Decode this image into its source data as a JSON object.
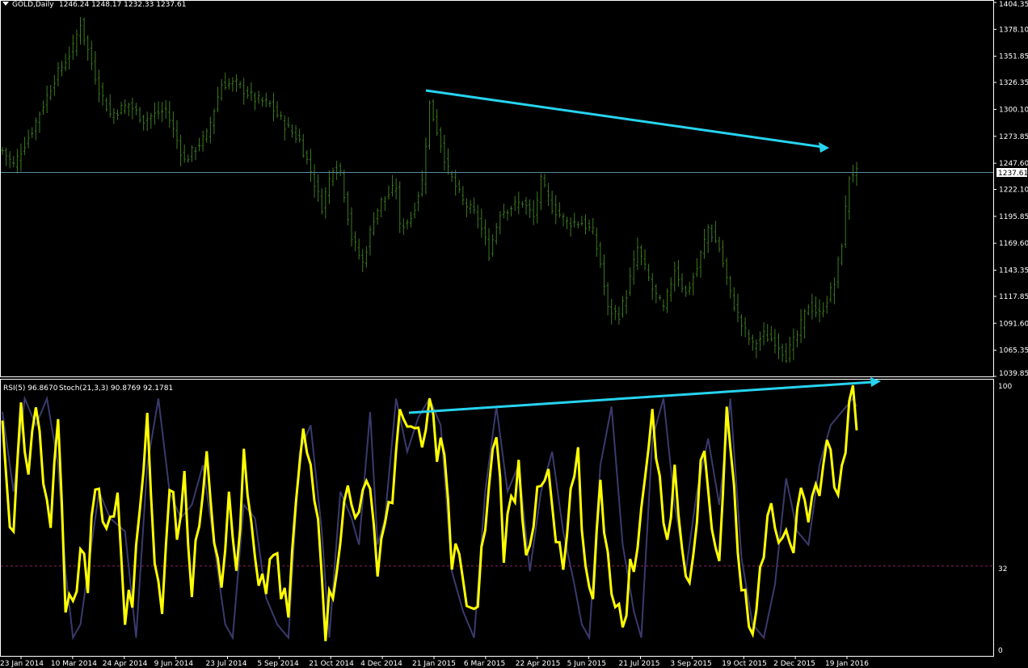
{
  "main_header": {
    "symbol_tf": "GOLD,Daily",
    "ohlc": "1246.24 1248.17 1232.33 1237.61"
  },
  "sub_header": {
    "rsi_label": "RSI(5) 96.8670",
    "stoch_label": "Stoch(21,3,3) 90.8769 92.1781"
  },
  "colors": {
    "background": "#000000",
    "frame": "#ffffff",
    "bars": "#3c7a1e",
    "bid_line": "#5a8a9a",
    "price_tag_bg": "#ffffff",
    "arrow": "#27d4f0",
    "rsi_line": "#ffff00",
    "stoch_line": "#3a3a6e",
    "level_line": "#8a2060"
  },
  "icons": {
    "header_marker": "down-triangle-icon"
  },
  "price_axis": [
    "1404.35",
    "1378.10",
    "1351.85",
    "1326.35",
    "1300.10",
    "1273.85",
    "1247.60",
    "1222.10",
    "1195.85",
    "1169.60",
    "1143.35",
    "1117.85",
    "1091.60",
    "1065.35",
    "1039.85"
  ],
  "current_price": "1237.61",
  "sub_axis": {
    "top": "100",
    "level": "32",
    "bottom": "0"
  },
  "date_axis": [
    "23 Jan 2014",
    "10 Mar 2014",
    "24 Apr 2014",
    "9 Jun 2014",
    "23 Jul 2014",
    "5 Sep 2014",
    "21 Oct 2014",
    "4 Dec 2014",
    "21 Jan 2015",
    "6 Mar 2015",
    "22 Apr 2015",
    "5 Jun 2015",
    "21 Jul 2015",
    "3 Sep 2015",
    "19 Oct 2015",
    "2 Dec 2015",
    "19 Jan 2016"
  ],
  "chart_data": {
    "type": "line",
    "series": [
      {
        "name": "GOLD,Daily",
        "anchors": [
          [
            0,
            1260
          ],
          [
            3,
            1246
          ],
          [
            8,
            1280
          ],
          [
            14,
            1330
          ],
          [
            19,
            1360
          ],
          [
            21,
            1385
          ],
          [
            22,
            1370
          ],
          [
            26,
            1320
          ],
          [
            29,
            1295
          ],
          [
            34,
            1305
          ],
          [
            38,
            1290
          ],
          [
            44,
            1300
          ],
          [
            49,
            1250
          ],
          [
            55,
            1275
          ],
          [
            59,
            1325
          ],
          [
            63,
            1325
          ],
          [
            68,
            1310
          ],
          [
            72,
            1305
          ],
          [
            76,
            1285
          ],
          [
            80,
            1270
          ],
          [
            83,
            1240
          ],
          [
            86,
            1205
          ],
          [
            89,
            1245
          ],
          [
            91,
            1240
          ],
          [
            94,
            1175
          ],
          [
            97,
            1150
          ],
          [
            100,
            1195
          ],
          [
            102,
            1210
          ],
          [
            106,
            1225
          ],
          [
            107,
            1185
          ],
          [
            110,
            1195
          ],
          [
            113,
            1230
          ],
          [
            115,
            1305
          ],
          [
            117,
            1280
          ],
          [
            120,
            1240
          ],
          [
            124,
            1210
          ],
          [
            128,
            1195
          ],
          [
            131,
            1160
          ],
          [
            134,
            1200
          ],
          [
            137,
            1205
          ],
          [
            140,
            1210
          ],
          [
            143,
            1195
          ],
          [
            145,
            1230
          ],
          [
            148,
            1205
          ],
          [
            152,
            1190
          ],
          [
            156,
            1190
          ],
          [
            159,
            1180
          ],
          [
            161,
            1150
          ],
          [
            163,
            1105
          ],
          [
            166,
            1100
          ],
          [
            168,
            1120
          ],
          [
            171,
            1165
          ],
          [
            175,
            1125
          ],
          [
            178,
            1105
          ],
          [
            181,
            1145
          ],
          [
            184,
            1120
          ],
          [
            187,
            1145
          ],
          [
            190,
            1185
          ],
          [
            193,
            1165
          ],
          [
            196,
            1120
          ],
          [
            199,
            1090
          ],
          [
            202,
            1070
          ],
          [
            205,
            1080
          ],
          [
            208,
            1075
          ],
          [
            211,
            1060
          ],
          [
            214,
            1080
          ],
          [
            217,
            1110
          ],
          [
            220,
            1100
          ],
          [
            224,
            1130
          ],
          [
            226,
            1170
          ],
          [
            228,
            1235
          ],
          [
            229,
            1238
          ]
        ]
      },
      {
        "name": "RSI(5)",
        "anchors": [
          [
            0,
            80
          ],
          [
            3,
            40
          ],
          [
            5,
            90
          ],
          [
            7,
            70
          ],
          [
            9,
            95
          ],
          [
            11,
            60
          ],
          [
            13,
            50
          ],
          [
            15,
            85
          ],
          [
            17,
            20
          ],
          [
            19,
            15
          ],
          [
            21,
            40
          ],
          [
            23,
            25
          ],
          [
            25,
            65
          ],
          [
            27,
            45
          ],
          [
            29,
            50
          ],
          [
            31,
            55
          ],
          [
            33,
            15
          ],
          [
            35,
            20
          ],
          [
            37,
            60
          ],
          [
            39,
            85
          ],
          [
            41,
            30
          ],
          [
            43,
            20
          ],
          [
            45,
            65
          ],
          [
            47,
            45
          ],
          [
            49,
            70
          ],
          [
            51,
            20
          ],
          [
            53,
            50
          ],
          [
            55,
            80
          ],
          [
            57,
            45
          ],
          [
            59,
            30
          ],
          [
            61,
            55
          ],
          [
            63,
            30
          ],
          [
            65,
            70
          ],
          [
            67,
            45
          ],
          [
            69,
            20
          ],
          [
            71,
            25
          ],
          [
            73,
            40
          ],
          [
            75,
            20
          ],
          [
            77,
            15
          ],
          [
            79,
            55
          ],
          [
            81,
            80
          ],
          [
            83,
            70
          ],
          [
            85,
            55
          ],
          [
            87,
            10
          ],
          [
            89,
            25
          ],
          [
            91,
            45
          ],
          [
            93,
            60
          ],
          [
            95,
            50
          ],
          [
            97,
            65
          ],
          [
            99,
            55
          ],
          [
            101,
            35
          ],
          [
            103,
            50
          ],
          [
            105,
            60
          ],
          [
            107,
            85
          ],
          [
            109,
            90
          ],
          [
            111,
            80
          ],
          [
            113,
            75
          ],
          [
            115,
            92
          ],
          [
            117,
            78
          ],
          [
            119,
            75
          ],
          [
            121,
            30
          ],
          [
            123,
            40
          ],
          [
            125,
            15
          ],
          [
            127,
            10
          ],
          [
            129,
            35
          ],
          [
            131,
            60
          ],
          [
            133,
            85
          ],
          [
            135,
            40
          ],
          [
            137,
            55
          ],
          [
            139,
            70
          ],
          [
            141,
            40
          ],
          [
            143,
            50
          ],
          [
            145,
            60
          ],
          [
            147,
            65
          ],
          [
            149,
            40
          ],
          [
            151,
            30
          ],
          [
            153,
            55
          ],
          [
            155,
            70
          ],
          [
            157,
            30
          ],
          [
            159,
            25
          ],
          [
            161,
            60
          ],
          [
            163,
            40
          ],
          [
            165,
            15
          ],
          [
            167,
            10
          ],
          [
            169,
            30
          ],
          [
            171,
            35
          ],
          [
            173,
            70
          ],
          [
            175,
            90
          ],
          [
            177,
            60
          ],
          [
            179,
            45
          ],
          [
            181,
            65
          ],
          [
            183,
            40
          ],
          [
            185,
            30
          ],
          [
            187,
            55
          ],
          [
            189,
            75
          ],
          [
            191,
            50
          ],
          [
            193,
            35
          ],
          [
            195,
            90
          ],
          [
            197,
            60
          ],
          [
            199,
            25
          ],
          [
            201,
            15
          ],
          [
            203,
            10
          ],
          [
            205,
            40
          ],
          [
            207,
            60
          ],
          [
            209,
            45
          ],
          [
            211,
            50
          ],
          [
            213,
            40
          ],
          [
            215,
            55
          ],
          [
            217,
            45
          ],
          [
            219,
            60
          ],
          [
            221,
            70
          ],
          [
            223,
            80
          ],
          [
            225,
            55
          ],
          [
            227,
            80
          ],
          [
            229,
            95
          ],
          [
            230,
            90
          ]
        ]
      },
      {
        "name": "Stoch(21,3,3)",
        "anchors": [
          [
            0,
            90
          ],
          [
            3,
            60
          ],
          [
            6,
            95
          ],
          [
            9,
            85
          ],
          [
            12,
            95
          ],
          [
            15,
            70
          ],
          [
            17,
            30
          ],
          [
            19,
            5
          ],
          [
            21,
            10
          ],
          [
            23,
            30
          ],
          [
            26,
            60
          ],
          [
            29,
            50
          ],
          [
            33,
            45
          ],
          [
            36,
            5
          ],
          [
            39,
            70
          ],
          [
            42,
            95
          ],
          [
            45,
            60
          ],
          [
            48,
            50
          ],
          [
            51,
            55
          ],
          [
            54,
            70
          ],
          [
            57,
            40
          ],
          [
            60,
            10
          ],
          [
            62,
            5
          ],
          [
            65,
            55
          ],
          [
            68,
            50
          ],
          [
            71,
            20
          ],
          [
            74,
            10
          ],
          [
            77,
            5
          ],
          [
            80,
            75
          ],
          [
            83,
            85
          ],
          [
            86,
            45
          ],
          [
            88,
            5
          ],
          [
            91,
            60
          ],
          [
            94,
            50
          ],
          [
            96,
            40
          ],
          [
            99,
            90
          ],
          [
            101,
            40
          ],
          [
            103,
            50
          ],
          [
            106,
            95
          ],
          [
            109,
            75
          ],
          [
            112,
            88
          ],
          [
            115,
            95
          ],
          [
            118,
            85
          ],
          [
            121,
            30
          ],
          [
            124,
            15
          ],
          [
            127,
            5
          ],
          [
            130,
            60
          ],
          [
            133,
            92
          ],
          [
            136,
            60
          ],
          [
            139,
            70
          ],
          [
            142,
            30
          ],
          [
            145,
            60
          ],
          [
            148,
            75
          ],
          [
            151,
            45
          ],
          [
            154,
            25
          ],
          [
            156,
            10
          ],
          [
            158,
            5
          ],
          [
            161,
            70
          ],
          [
            164,
            92
          ],
          [
            167,
            40
          ],
          [
            170,
            15
          ],
          [
            172,
            5
          ],
          [
            175,
            80
          ],
          [
            178,
            95
          ],
          [
            181,
            55
          ],
          [
            184,
            30
          ],
          [
            187,
            60
          ],
          [
            190,
            80
          ],
          [
            193,
            55
          ],
          [
            196,
            95
          ],
          [
            199,
            35
          ],
          [
            202,
            10
          ],
          [
            205,
            5
          ],
          [
            208,
            25
          ],
          [
            211,
            65
          ],
          [
            214,
            45
          ],
          [
            217,
            40
          ],
          [
            220,
            70
          ],
          [
            223,
            85
          ],
          [
            226,
            90
          ],
          [
            229,
            95
          ],
          [
            230,
            92
          ]
        ]
      }
    ],
    "title": "GOLD,Daily",
    "ylim_price": [
      1039.85,
      1404.35
    ],
    "ylim_indicator": [
      0,
      100
    ],
    "level": 32,
    "grid": false
  }
}
